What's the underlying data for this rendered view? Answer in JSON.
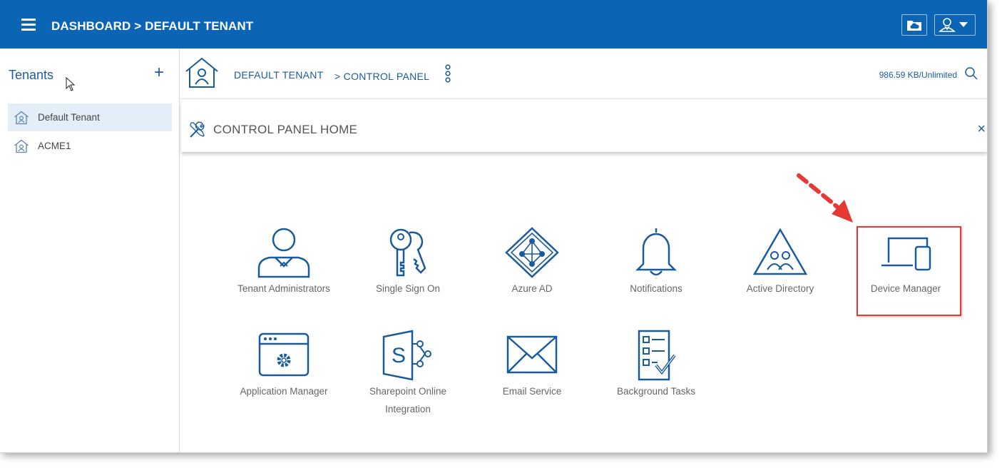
{
  "header": {
    "title": "DASHBOARD > DEFAULT TENANT",
    "icons": [
      "menu-icon",
      "cloud-folder-icon",
      "user-menu-icon"
    ]
  },
  "sidebar": {
    "title": "Tenants",
    "add_label": "+",
    "items": [
      {
        "label": "Default Tenant",
        "icon": "home-icon",
        "selected": true
      },
      {
        "label": "ACME1",
        "icon": "home-icon",
        "selected": false
      }
    ]
  },
  "breadcrumb": {
    "item1": "DEFAULT TENANT",
    "item2": "> CONTROL PANEL"
  },
  "storage": {
    "usage": "986.59 KB/Unlimited"
  },
  "panel": {
    "title": "CONTROL PANEL HOME",
    "close": "×"
  },
  "tiles": [
    {
      "label": "Tenant Administrators",
      "icon": "admin-user-icon"
    },
    {
      "label": "Single Sign On",
      "icon": "keys-icon"
    },
    {
      "label": "Azure AD",
      "icon": "azure-ad-icon"
    },
    {
      "label": "Notifications",
      "icon": "bell-icon"
    },
    {
      "label": "Active Directory",
      "icon": "active-directory-icon"
    },
    {
      "label": "Device Manager",
      "icon": "devices-icon",
      "highlighted": true
    },
    {
      "label": "Application Manager",
      "icon": "app-window-gear-icon"
    },
    {
      "label": "Sharepoint Online Integration",
      "icon": "sharepoint-icon"
    },
    {
      "label": "Email Service",
      "icon": "envelope-icon"
    },
    {
      "label": "Background Tasks",
      "icon": "checklist-icon"
    }
  ],
  "colors": {
    "brand": "#0b64b4",
    "icon": "#1a5b9c",
    "highlight": "#e53935"
  }
}
